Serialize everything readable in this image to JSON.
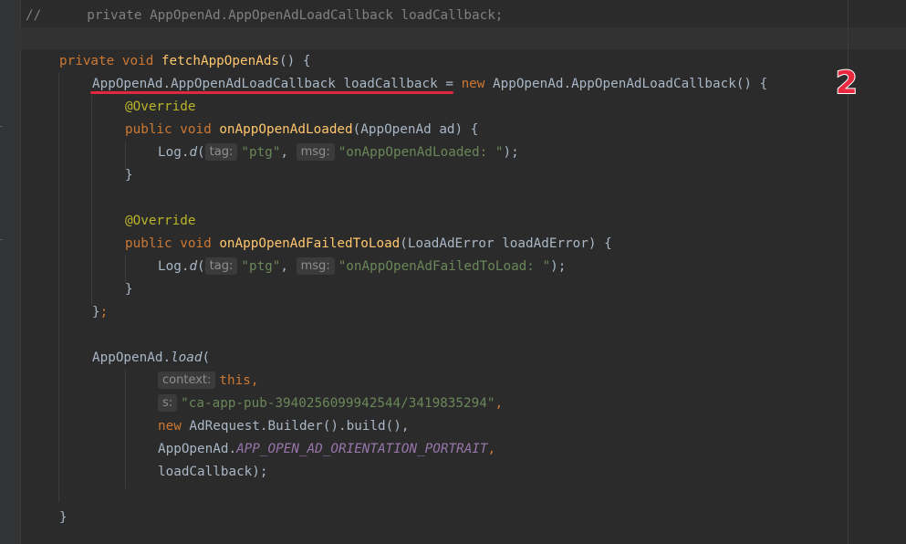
{
  "code": {
    "l1": {
      "comment_prefix": "//",
      "text": "private AppOpenAd.AppOpenAdLoadCallback loadCallback;"
    },
    "l2": {
      "kw_private": "private",
      "kw_void": "void",
      "method": "fetchAppOpenAds",
      "rest": "() {"
    },
    "l3": {
      "decl": "AppOpenAd.AppOpenAdLoadCallback loadCallback",
      "eq": " = ",
      "kw_new": "new",
      "rest": " AppOpenAd.AppOpenAdLoadCallback() {"
    },
    "l4": {
      "annotation": "@Override"
    },
    "l5": {
      "kw_public": "public",
      "kw_void": "void",
      "method": "onAppOpenAdLoaded",
      "rest": "(AppOpenAd ad) {"
    },
    "l6": {
      "log": "Log.",
      "d": "d",
      "open": "(",
      "hint_tag": "tag:",
      "tag_str": "\"ptg\"",
      "comma": ", ",
      "hint_msg": "msg:",
      "msg_str": "\"onAppOpenAdLoaded: \"",
      "close": ");"
    },
    "l7": {
      "text": "}"
    },
    "l9": {
      "annotation": "@Override"
    },
    "l10": {
      "kw_public": "public",
      "kw_void": "void",
      "method": "onAppOpenAdFailedToLoad",
      "rest": "(LoadAdError loadAdError) {"
    },
    "l11": {
      "log": "Log.",
      "d": "d",
      "open": "(",
      "hint_tag": "tag:",
      "tag_str": "\"ptg\"",
      "comma": ", ",
      "hint_msg": "msg:",
      "msg_str": "\"onAppOpenAdFailedToLoad: \"",
      "close": ");"
    },
    "l12": {
      "text": "}"
    },
    "l13": {
      "text": "}",
      "semi": ";"
    },
    "l15": {
      "cls": "AppOpenAd.",
      "method": "load",
      "open": "("
    },
    "l16": {
      "hint": "context:",
      "kw_this": "this",
      "comma": ","
    },
    "l17": {
      "hint": "s:",
      "str": "\"ca-app-pub-3940256099942544/3419835294\"",
      "comma": ","
    },
    "l18": {
      "kw_new": "new",
      "rest": " AdRequest.Builder().build(),"
    },
    "l19": {
      "cls": "AppOpenAd.",
      "const": "APP_OPEN_AD_ORIENTATION_PORTRAIT",
      "comma": ","
    },
    "l20": {
      "text": "loadCallback);"
    },
    "l22": {
      "text": "}"
    }
  },
  "annotation_marker": {
    "label": "2",
    "color": "#e8293f"
  },
  "colors": {
    "background": "#2b2b2b",
    "keyword": "#cc7832",
    "method": "#ffc66d",
    "annotation": "#bbb529",
    "string": "#6a8759",
    "constant": "#9876aa",
    "comment": "#808080",
    "underline": "#e0283e"
  }
}
